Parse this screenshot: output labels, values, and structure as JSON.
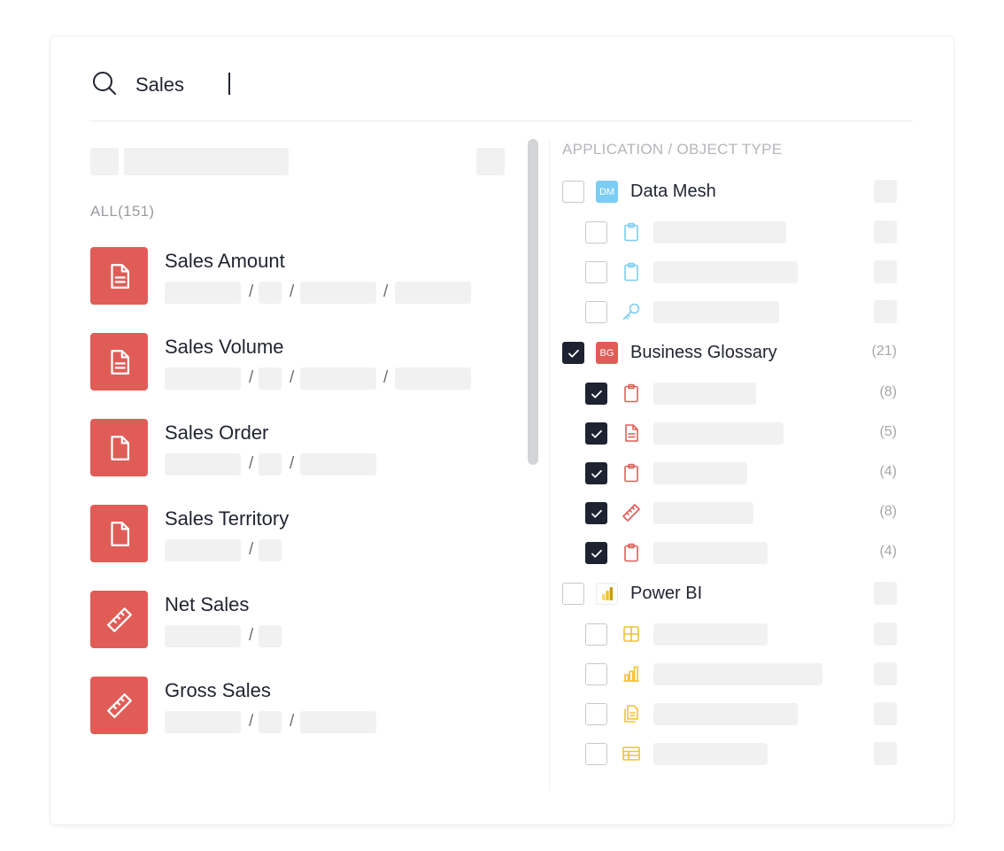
{
  "search": {
    "query": "Sales"
  },
  "results": {
    "all_label": "ALL(151)",
    "items": [
      {
        "name": "Sales Amount",
        "icon": "document-lines-icon",
        "path_segments": 4
      },
      {
        "name": "Sales Volume",
        "icon": "document-lines-icon",
        "path_segments": 4
      },
      {
        "name": "Sales Order",
        "icon": "document-icon",
        "path_segments": 3
      },
      {
        "name": "Sales Territory",
        "icon": "document-icon",
        "path_segments": 2
      },
      {
        "name": "Net Sales",
        "icon": "ruler-icon",
        "path_segments": 2
      },
      {
        "name": "Gross Sales",
        "icon": "ruler-icon",
        "path_segments": 3
      }
    ]
  },
  "filters": {
    "title": "APPLICATION / OBJECT TYPE",
    "groups": [
      {
        "badge": "DM",
        "badge_color": "#7ccdf3",
        "name": "Data Mesh",
        "checked": false,
        "count": "",
        "children": [
          {
            "icon": "clipboard-icon",
            "color": "#7ccdf3",
            "checked": false,
            "count": ""
          },
          {
            "icon": "clipboard-icon",
            "color": "#7ccdf3",
            "checked": false,
            "count": ""
          },
          {
            "icon": "key-icon",
            "color": "#7ccdf3",
            "checked": false,
            "count": ""
          }
        ]
      },
      {
        "badge": "BG",
        "badge_color": "#e05d57",
        "name": "Business Glossary",
        "checked": true,
        "count": "(21)",
        "children": [
          {
            "icon": "clipboard-icon",
            "color": "#e05d57",
            "checked": true,
            "count": "(8)"
          },
          {
            "icon": "document-lines-icon",
            "color": "#e05d57",
            "checked": true,
            "count": "(5)"
          },
          {
            "icon": "clipboard-icon",
            "color": "#e05d57",
            "checked": true,
            "count": "(4)"
          },
          {
            "icon": "ruler-icon",
            "color": "#e05d57",
            "checked": true,
            "count": "(8)"
          },
          {
            "icon": "clipboard-icon",
            "color": "#e05d57",
            "checked": true,
            "count": "(4)"
          }
        ]
      },
      {
        "badge": "",
        "badge_color": "#f2c230",
        "name": "Power BI",
        "checked": false,
        "count": "",
        "children": [
          {
            "icon": "grid-icon",
            "color": "#f2c230",
            "checked": false,
            "count": ""
          },
          {
            "icon": "bar-chart-icon",
            "color": "#f2c230",
            "checked": false,
            "count": ""
          },
          {
            "icon": "report-icon",
            "color": "#f2c230",
            "checked": false,
            "count": ""
          },
          {
            "icon": "table-icon",
            "color": "#f2c230",
            "checked": false,
            "count": ""
          }
        ]
      }
    ]
  }
}
